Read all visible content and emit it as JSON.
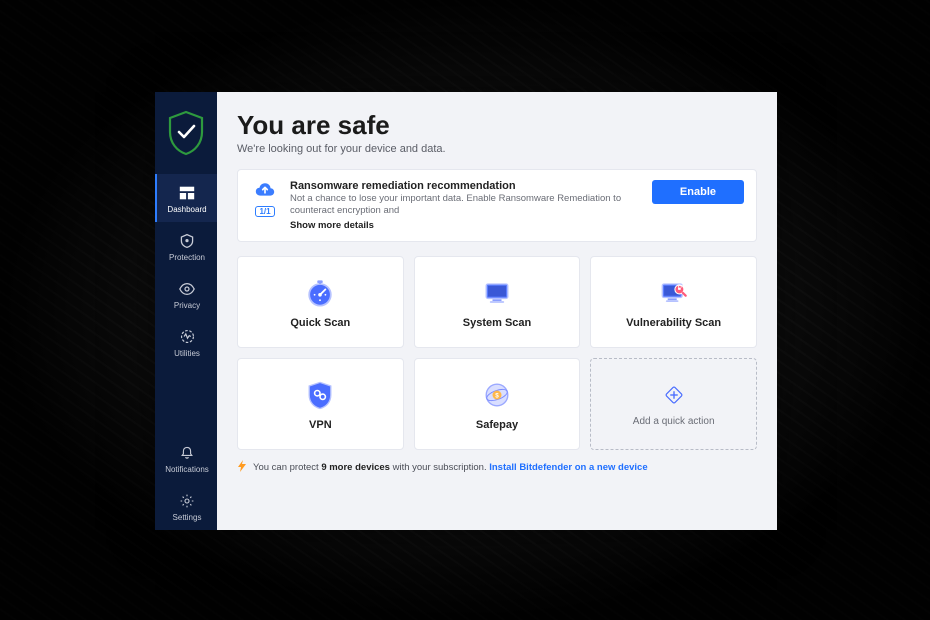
{
  "sidebar": {
    "items": [
      {
        "label": "Dashboard"
      },
      {
        "label": "Protection"
      },
      {
        "label": "Privacy"
      },
      {
        "label": "Utilities"
      }
    ],
    "bottom": [
      {
        "label": "Notifications"
      },
      {
        "label": "Settings"
      }
    ]
  },
  "hero": {
    "title": "You are safe",
    "subtitle": "We're looking out for your device and data."
  },
  "reco": {
    "title": "Ransomware remediation recommendation",
    "desc": "Not a chance to lose your important data. Enable Ransomware Remediation to counteract encryption and",
    "more": "Show more details",
    "badge": "1/1",
    "button": "Enable"
  },
  "cards": [
    {
      "label": "Quick Scan"
    },
    {
      "label": "System Scan"
    },
    {
      "label": "Vulnerability Scan"
    },
    {
      "label": "VPN"
    },
    {
      "label": "Safepay"
    }
  ],
  "add_card": {
    "label": "Add a quick action"
  },
  "footer": {
    "pre": "You can protect ",
    "bold": "9 more devices",
    "mid": " with your subscription. ",
    "link": "Install Bitdefender on a new device"
  }
}
